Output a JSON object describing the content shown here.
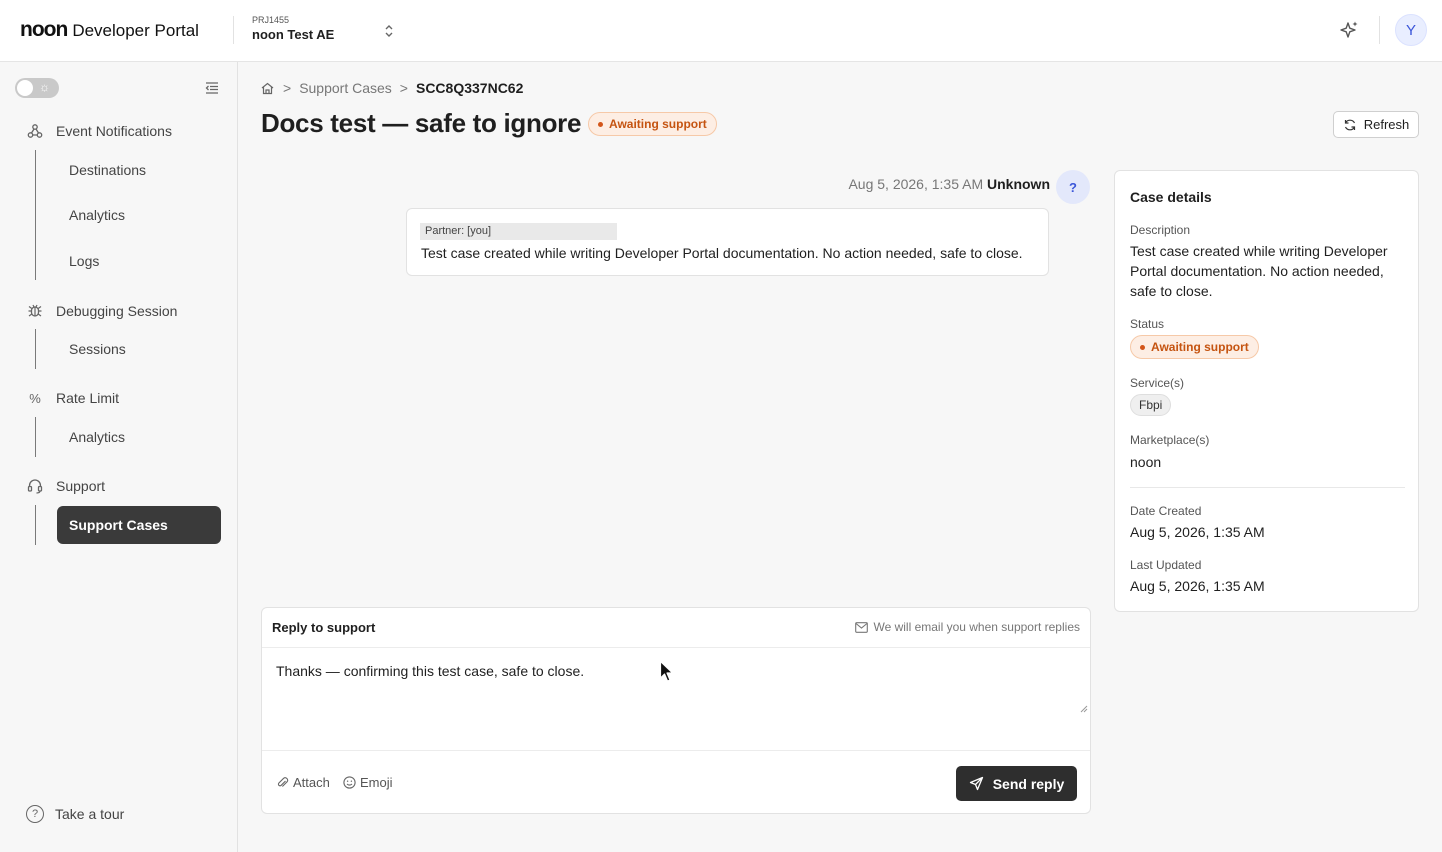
{
  "app": {
    "logo_mark": "noon",
    "logo_text": "Developer Portal",
    "project_id": "PRJ1455",
    "project_name": "noon Test AE",
    "avatar_initial": "Y"
  },
  "sidebar": {
    "sections": [
      {
        "label": "Event Notifications",
        "icon": "webhook-icon",
        "items": [
          "Destinations",
          "Analytics",
          "Logs"
        ]
      },
      {
        "label": "Debugging Session",
        "icon": "bug-icon",
        "items": [
          "Sessions"
        ]
      },
      {
        "label": "Rate Limit",
        "icon": "percent-icon",
        "items": [
          "Analytics"
        ]
      },
      {
        "label": "Support",
        "icon": "headset-icon",
        "items": [
          "Support Cases"
        ]
      }
    ],
    "active_item": "Support Cases",
    "tour_label": "Take a tour"
  },
  "breadcrumb": {
    "home_icon": "home-icon",
    "items": [
      "Support Cases",
      "SCC8Q337NC62"
    ],
    "separator": ">"
  },
  "page": {
    "title": "Docs test — safe to ignore",
    "status": "Awaiting support",
    "refresh_label": "Refresh"
  },
  "message": {
    "timestamp": "Aug 5, 2026, 1:35 AM",
    "author": "Unknown",
    "avatar": "?",
    "partner_tag": "Partner: [you]",
    "text": "Test case created while writing Developer Portal documentation. No action needed, safe to close."
  },
  "reply": {
    "title": "Reply to support",
    "note": "We will email you when support replies",
    "value": "Thanks — confirming this test case, safe to close.",
    "attach_label": "Attach",
    "emoji_label": "Emoji",
    "send_label": "Send reply"
  },
  "details": {
    "title": "Case details",
    "description_label": "Description",
    "description": "Test case created while writing Developer Portal documentation. No action needed, safe to close.",
    "status_label": "Status",
    "status": "Awaiting support",
    "services_label": "Service(s)",
    "service": "Fbpi",
    "marketplaces_label": "Marketplace(s)",
    "marketplace": "noon",
    "created_label": "Date Created",
    "created": "Aug 5, 2026, 1:35 AM",
    "updated_label": "Last Updated",
    "updated": "Aug 5, 2026, 1:35 AM"
  },
  "colors": {
    "status_text": "#c55411",
    "status_bg": "#fdeee4",
    "primary_button": "#2e2e2e",
    "avatar_accent": "#3b56d9"
  }
}
